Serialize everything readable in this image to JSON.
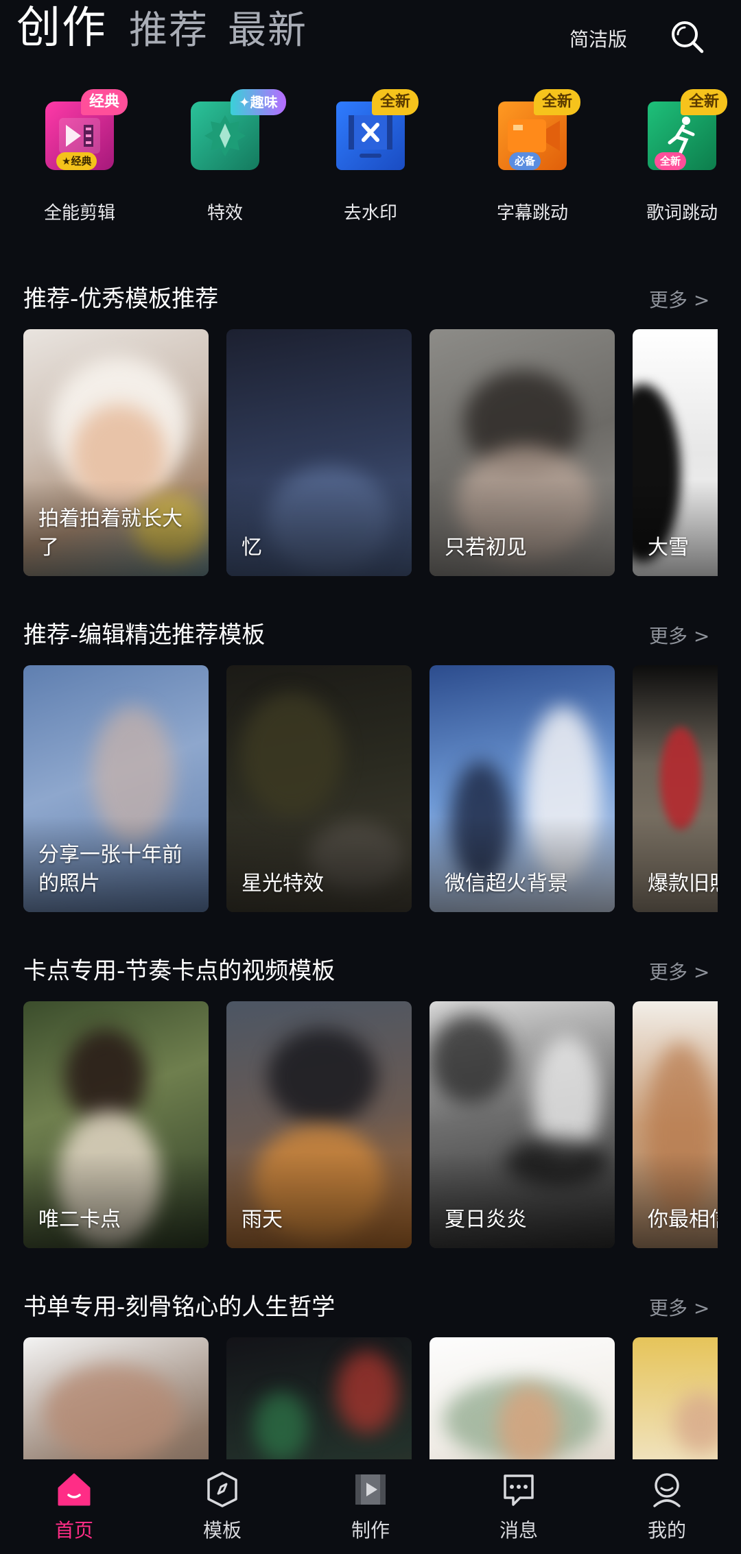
{
  "header": {
    "tabs": [
      {
        "label": "创作",
        "active": true
      },
      {
        "label": "推荐",
        "active": false
      },
      {
        "label": "最新",
        "active": false
      }
    ],
    "simple_mode_label": "简洁版",
    "search_icon": "search-icon"
  },
  "tools": [
    {
      "label": "全能剪辑",
      "badge": "经典",
      "mini_badge": "★经典",
      "icon": "film-edit-icon"
    },
    {
      "label": "特效",
      "badge": "✦趣味",
      "mini_badge": "",
      "icon": "effect-icon"
    },
    {
      "label": "去水印",
      "badge": "全新",
      "mini_badge": "",
      "icon": "remove-watermark-icon"
    },
    {
      "label": "字幕跳动",
      "badge": "全新",
      "mini_badge": "必备",
      "icon": "subtitle-camera-icon"
    },
    {
      "label": "歌词跳动",
      "badge": "全新",
      "mini_badge": "全新",
      "icon": "lyrics-dance-icon"
    }
  ],
  "sections": [
    {
      "title": "推荐-优秀模板推荐",
      "more": "更多 >",
      "cards": [
        {
          "title": "拍着拍着就长大了"
        },
        {
          "title": "忆"
        },
        {
          "title": "只若初见"
        },
        {
          "title": "大雪"
        }
      ]
    },
    {
      "title": "推荐-编辑精选推荐模板",
      "more": "更多 >",
      "cards": [
        {
          "title": "分享一张十年前的照片"
        },
        {
          "title": "星光特效"
        },
        {
          "title": "微信超火背景"
        },
        {
          "title": "爆款旧照"
        }
      ]
    },
    {
      "title": "卡点专用-节奏卡点的视频模板",
      "more": "更多 >",
      "cards": [
        {
          "title": "唯二卡点"
        },
        {
          "title": "雨天"
        },
        {
          "title": "夏日炎炎"
        },
        {
          "title": "你最相信"
        }
      ]
    },
    {
      "title": "书单专用-刻骨铭心的人生哲学",
      "more": "更多 >",
      "cards": [
        {
          "title": ""
        },
        {
          "title": ""
        },
        {
          "title": ""
        },
        {
          "title": ""
        }
      ]
    }
  ],
  "bottom_nav": [
    {
      "label": "首页",
      "icon": "home-icon",
      "active": true
    },
    {
      "label": "模板",
      "icon": "compass-icon",
      "active": false
    },
    {
      "label": "制作",
      "icon": "video-make-icon",
      "active": false
    },
    {
      "label": "消息",
      "icon": "message-icon",
      "active": false
    },
    {
      "label": "我的",
      "icon": "profile-icon",
      "active": false
    }
  ],
  "colors": {
    "background": "#0b0d12",
    "accent": "#ff2d86",
    "muted_text": "#8f939b"
  }
}
